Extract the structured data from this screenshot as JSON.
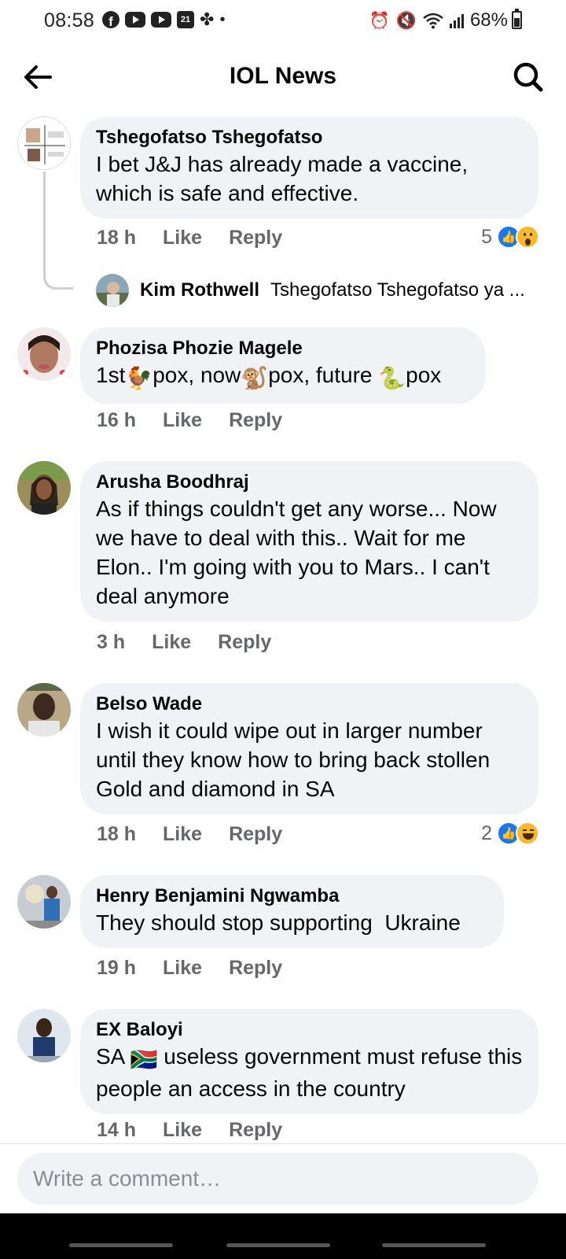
{
  "status_bar": {
    "time": "08:58",
    "calendar_day": "21",
    "battery": "68%",
    "icons": [
      "facebook-icon",
      "youtube-icon",
      "youtube-icon",
      "calendar-icon",
      "pinwheel-icon",
      "dot-icon",
      "alarm-icon",
      "mute-icon",
      "wifi-icon",
      "signal-icon",
      "battery-icon"
    ]
  },
  "header": {
    "title": "IOL News",
    "back_icon": "back-arrow-icon",
    "search_icon": "search-icon"
  },
  "comments": [
    {
      "author": "Tshegofatso Tshegofatso",
      "text": "I bet J&J has already made a vaccine, which is safe and effective.",
      "time": "18 h",
      "like": "Like",
      "reply": "Reply",
      "reaction_count": "5",
      "reactions": [
        "like",
        "wow"
      ],
      "reply_preview": {
        "author": "Kim Rothwell",
        "text": "Tshegofatso Tshegofatso ya ..."
      }
    },
    {
      "author": "Phozisa Phozie Magele",
      "text_parts": [
        "1st",
        "pox, now",
        "pox, future ",
        "pox"
      ],
      "emojis": [
        "🐓",
        "🐒",
        "🐍"
      ],
      "time": "16 h",
      "like": "Like",
      "reply": "Reply"
    },
    {
      "author": "Arusha Boodhraj",
      "text": "As if things couldn't get any worse... Now we have to deal with this.. Wait for me Elon.. I'm going with you to Mars.. I can't deal anymore",
      "time": "3 h",
      "like": "Like",
      "reply": "Reply"
    },
    {
      "author": "Belso Wade",
      "text": "I wish it could wipe out in larger number until they know how to bring back stollen Gold and diamond in SA",
      "time": "18 h",
      "like": "Like",
      "reply": "Reply",
      "reaction_count": "2",
      "reactions": [
        "like",
        "haha"
      ]
    },
    {
      "author": "Henry Benjamini Ngwamba",
      "text": "They should stop supporting  Ukraine",
      "time": "19 h",
      "like": "Like",
      "reply": "Reply"
    },
    {
      "author": "EX Baloyi",
      "text_parts": [
        "SA ",
        " useless government must refuse this people an access in the country"
      ],
      "emojis": [
        "🇿🇦"
      ],
      "time": "14 h",
      "like": "Like",
      "reply": "Reply"
    }
  ],
  "composer": {
    "placeholder": "Write a comment…"
  },
  "colors": {
    "bubble": "#f0f2f5",
    "meta_text": "#65676b",
    "like_blue": "#1877f2",
    "reaction_yellow": "#f7b928"
  }
}
